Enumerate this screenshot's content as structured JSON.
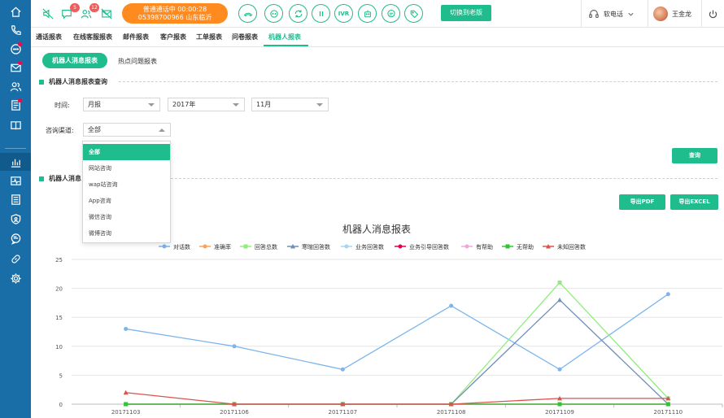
{
  "topbar": {
    "msg_badge": "5",
    "user_badge": "12",
    "call_status": "普通通话中  00:00:28",
    "call_number": "05398700966 山东临沂",
    "ivr_label": "IVR",
    "switch_label": "切换到老版",
    "phone_label": "软电话",
    "user_name": "王金龙"
  },
  "tabs": [
    {
      "label": "通话报表"
    },
    {
      "label": "在线客服报表"
    },
    {
      "label": "邮件报表"
    },
    {
      "label": "客户报表"
    },
    {
      "label": "工单报表"
    },
    {
      "label": "问卷报表"
    },
    {
      "label": "机器人报表"
    }
  ],
  "subtabs": {
    "active": "机器人消息报表",
    "other": "热点问题报表"
  },
  "query": {
    "section_title": "机器人消息报表查询",
    "time_label": "时间:",
    "period": "月报",
    "year": "2017年",
    "month": "11月",
    "channel_label": "咨询渠道:",
    "channel": "全部",
    "query_button": "查询"
  },
  "dropdown": {
    "options": [
      "全部",
      "网站咨询",
      "wap站咨询",
      "App咨询",
      "微信咨询",
      "微博咨询"
    ]
  },
  "report": {
    "section_title_visible": "机器人消息",
    "export_pdf": "导出PDF",
    "export_excel": "导出EXCEL"
  },
  "chart_data": {
    "type": "line",
    "title": "机器人消息报表",
    "categories": [
      "20171103",
      "20171106",
      "20171107",
      "20171108",
      "20171109",
      "20171110"
    ],
    "ylim": [
      0,
      25
    ],
    "yticks": [
      0,
      5,
      10,
      15,
      20,
      25
    ],
    "grid": true,
    "legend_position": "top",
    "series": [
      {
        "name": "对话数",
        "color": "#7cb5ec",
        "marker": "circle",
        "values": [
          13,
          10,
          6,
          17,
          6,
          19
        ]
      },
      {
        "name": "准确率",
        "color": "#f7a35c",
        "marker": "circle",
        "values": [
          0,
          0,
          0,
          0,
          0,
          0
        ]
      },
      {
        "name": "回答总数",
        "color": "#90ed7d",
        "marker": "square",
        "values": [
          0,
          0,
          0,
          0,
          21,
          1
        ]
      },
      {
        "name": "寒暄回答数",
        "color": "#6f8fb5",
        "marker": "triangle",
        "values": [
          0,
          0,
          0,
          0,
          18,
          0
        ]
      },
      {
        "name": "业务回答数",
        "color": "#a6d5f2",
        "marker": "circle",
        "values": [
          0,
          0,
          0,
          0,
          0,
          0
        ]
      },
      {
        "name": "业务引导回答数",
        "color": "#e4004f",
        "marker": "circle",
        "values": [
          0,
          0,
          0,
          0,
          0,
          0
        ]
      },
      {
        "name": "有帮助",
        "color": "#f2a6d8",
        "marker": "circle",
        "values": [
          0,
          0,
          0,
          0,
          0,
          0
        ]
      },
      {
        "name": "无帮助",
        "color": "#2ec72e",
        "marker": "square",
        "values": [
          0,
          0,
          0,
          0,
          0,
          0
        ]
      },
      {
        "name": "未知回答数",
        "color": "#d9534f",
        "marker": "triangle",
        "values": [
          2,
          0,
          0,
          0,
          1,
          1
        ]
      }
    ]
  }
}
